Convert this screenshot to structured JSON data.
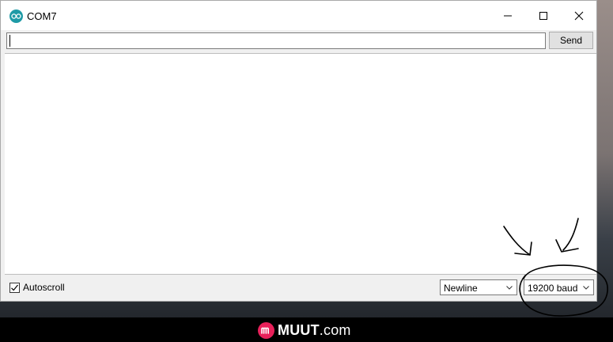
{
  "window": {
    "title": "COM7"
  },
  "input_row": {
    "input_value": "",
    "send_label": "Send"
  },
  "output": {
    "text": ""
  },
  "bottom_row": {
    "autoscroll_label": "Autoscroll",
    "autoscroll_checked": true,
    "line_ending_selected": "Newline",
    "baud_selected": "19200 baud"
  },
  "watermark": {
    "brand": "MUUT",
    "suffix": ".com"
  },
  "icons": {
    "app": "arduino-icon",
    "minimize": "minimize-icon",
    "maximize": "maximize-icon",
    "close": "close-icon",
    "dropdown": "chevron-down-icon",
    "check": "checkmark-icon"
  },
  "colors": {
    "app_icon": "#1e9aa6",
    "watermark_logo": "#e8205a"
  }
}
